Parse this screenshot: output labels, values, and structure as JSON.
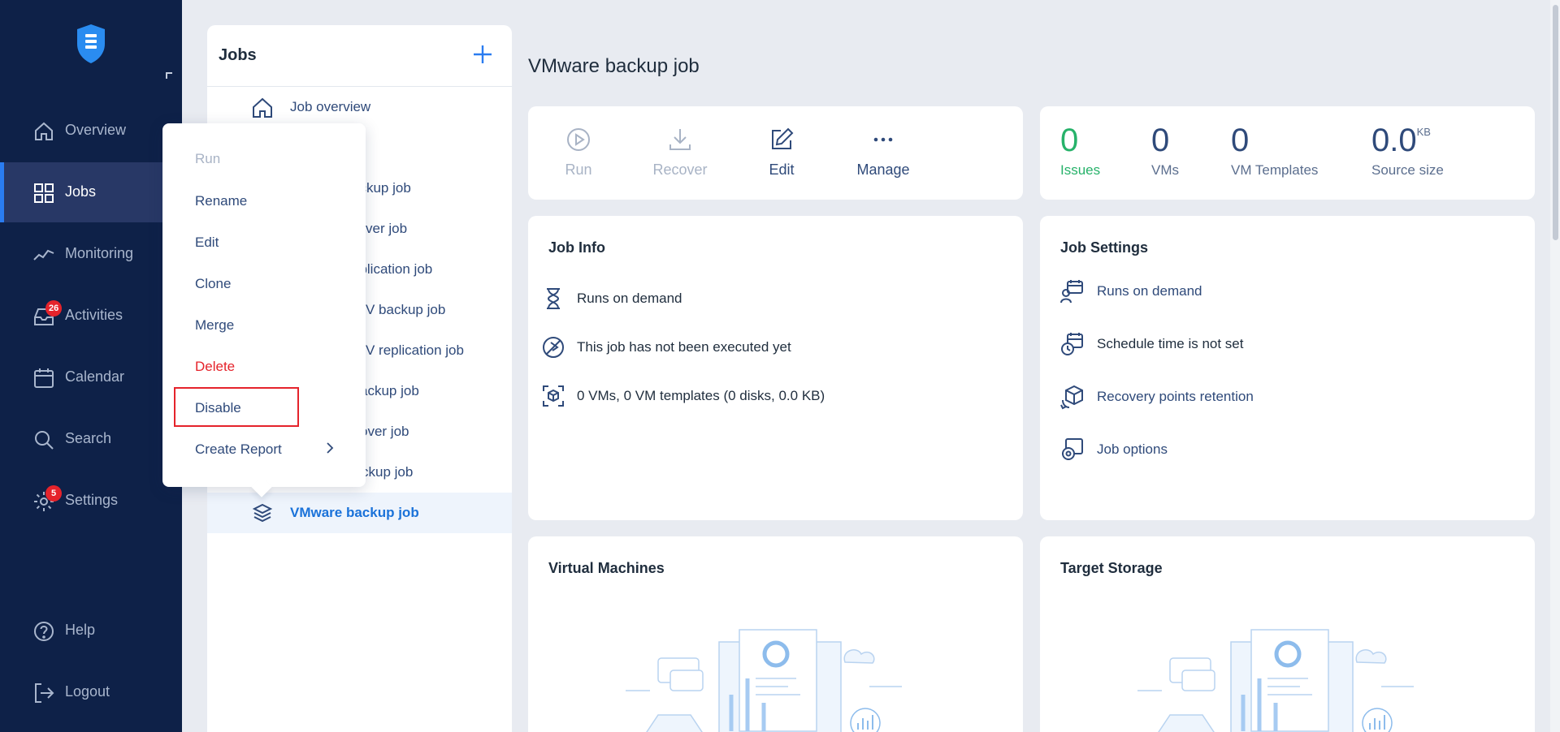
{
  "sidebar": {
    "items": [
      {
        "label": "Overview",
        "icon": "home-icon"
      },
      {
        "label": "Jobs",
        "icon": "grid-icon",
        "active": true
      },
      {
        "label": "Monitoring",
        "icon": "chart-line-icon"
      },
      {
        "label": "Activities",
        "icon": "inbox-icon",
        "badge": "26"
      },
      {
        "label": "Calendar",
        "icon": "calendar-icon"
      },
      {
        "label": "Search",
        "icon": "search-icon"
      },
      {
        "label": "Settings",
        "icon": "gear-icon",
        "badge": "5"
      },
      {
        "label": "Help",
        "icon": "help-icon"
      },
      {
        "label": "Logout",
        "icon": "logout-icon"
      }
    ]
  },
  "jobs_panel": {
    "title": "Jobs",
    "items": [
      {
        "label": "Job overview"
      },
      {
        "label": "ackup job"
      },
      {
        "label": "ilover job"
      },
      {
        "label": "eplication job"
      },
      {
        "label": "V backup job"
      },
      {
        "label": "V replication job"
      },
      {
        "label": "ackup job"
      },
      {
        "label": "over job"
      },
      {
        "label": "ckup job"
      },
      {
        "label": "VMware backup job"
      }
    ]
  },
  "context_menu": {
    "items": [
      "Run",
      "Rename",
      "Edit",
      "Clone",
      "Merge",
      "Delete",
      "Disable",
      "Create Report"
    ]
  },
  "main": {
    "title": "VMware backup job",
    "actions": [
      {
        "label": "Run",
        "icon": "play-circle-icon",
        "enabled": false
      },
      {
        "label": "Recover",
        "icon": "download-icon",
        "enabled": false
      },
      {
        "label": "Edit",
        "icon": "edit-icon",
        "enabled": true
      },
      {
        "label": "Manage",
        "icon": "more-icon",
        "enabled": true
      }
    ],
    "stats": [
      {
        "value": "0",
        "label": "Issues",
        "color": "#27b26a"
      },
      {
        "value": "0",
        "label": "VMs"
      },
      {
        "value": "0",
        "label": "VM Templates"
      },
      {
        "value": "0.0",
        "unit": "KB",
        "label": "Source size"
      }
    ],
    "job_info": {
      "title": "Job Info",
      "rows": [
        "Runs on demand",
        "This job has not been executed yet",
        "0 VMs, 0 VM templates (0 disks, 0.0 KB)"
      ]
    },
    "job_settings": {
      "title": "Job Settings",
      "rows": [
        "Runs on demand",
        "Schedule time is not set",
        "Recovery points retention",
        "Job options"
      ]
    },
    "virtual_machines": {
      "title": "Virtual Machines"
    },
    "target_storage": {
      "title": "Target Storage"
    }
  },
  "colors": {
    "sidebar_bg": "#0e2148",
    "accent": "#2a7cf0",
    "danger": "#e5232b",
    "success": "#27b26a"
  }
}
